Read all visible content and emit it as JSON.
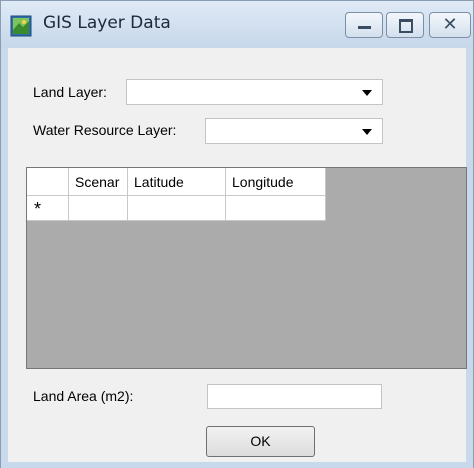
{
  "window": {
    "title": "GIS Layer Data",
    "close_glyph": "✕",
    "icon": "gis-app-icon"
  },
  "form": {
    "land_layer_label": "Land Layer:",
    "land_layer_value": "",
    "water_layer_label": "Water Resource Layer:",
    "water_layer_value": "",
    "land_area_label": "Land Area (m2):",
    "land_area_value": "",
    "ok_label": "OK"
  },
  "grid": {
    "columns": [
      "Scenar",
      "Latitude",
      "Longitude"
    ],
    "new_row_marker": "*",
    "rows": []
  },
  "colors": {
    "grid_background": "#ababab",
    "dialog_background": "#f0f0f0",
    "frame": "#c8d9ec"
  }
}
